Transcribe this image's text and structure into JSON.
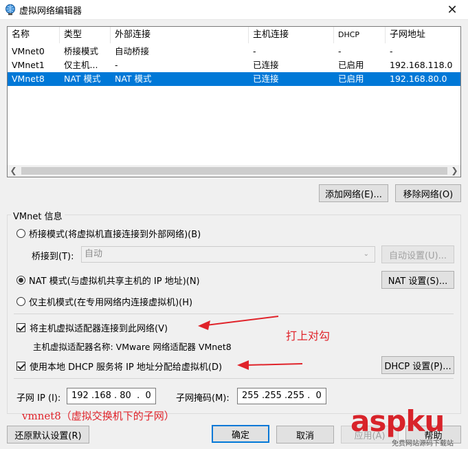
{
  "window": {
    "title": "虚拟网络编辑器",
    "close_glyph": "✕"
  },
  "network_list": {
    "columns": [
      "名称",
      "类型",
      "外部连接",
      "主机连接",
      "DHCP",
      "子网地址"
    ],
    "rows": [
      {
        "name": "VMnet0",
        "type": "桥接模式",
        "external": "自动桥接",
        "host": "-",
        "dhcp": "-",
        "subnet": "-"
      },
      {
        "name": "VMnet1",
        "type": "仅主机...",
        "external": "-",
        "host": "已连接",
        "dhcp": "已启用",
        "subnet": "192.168.118.0"
      },
      {
        "name": "VMnet8",
        "type": "NAT 模式",
        "external": "NAT 模式",
        "host": "已连接",
        "dhcp": "已启用",
        "subnet": "192.168.80.0"
      }
    ],
    "selected_index": 2
  },
  "list_buttons": {
    "add": "添加网络(E)...",
    "remove": "移除网络(O)"
  },
  "vmnet_info": {
    "legend": "VMnet 信息",
    "bridge_radio": "桥接模式(将虚拟机直接连接到外部网络)(B)",
    "bridge_to_label": "桥接到(T):",
    "bridge_to_value": "自动",
    "auto_settings": "自动设置(U)...",
    "nat_radio": "NAT 模式(与虚拟机共享主机的 IP 地址)(N)",
    "nat_settings": "NAT 设置(S)...",
    "hostonly_radio": "仅主机模式(在专用网络内连接虚拟机)(H)",
    "selected_mode": "nat",
    "connect_adapter_check": "将主机虚拟适配器连接到此网络(V)",
    "connect_adapter_checked": true,
    "adapter_name": "主机虚拟适配器名称: VMware 网络适配器 VMnet8",
    "dhcp_check": "使用本地 DHCP 服务将 IP 地址分配给虚拟机(D)",
    "dhcp_checked": true,
    "dhcp_settings": "DHCP 设置(P)...",
    "subnet_ip_label": "子网 IP (I):",
    "subnet_ip_value": "192 .168 . 80  .  0",
    "subnet_mask_label": "子网掩码(M):",
    "subnet_mask_value": "255 .255 .255 .  0"
  },
  "footer": {
    "restore": "还原默认设置(R)",
    "ok": "确定",
    "cancel": "取消",
    "apply": "应用(A)",
    "help": "帮助"
  },
  "annotations": {
    "check_note": "打上对勾",
    "subnet_note": "vmnet8（虚拟交换机下的子网）"
  },
  "watermark": {
    "brand": "aspku",
    "tagline": "免费网站源码下载站"
  },
  "colors": {
    "selection": "#0078d7",
    "annotation": "#e0232a"
  }
}
